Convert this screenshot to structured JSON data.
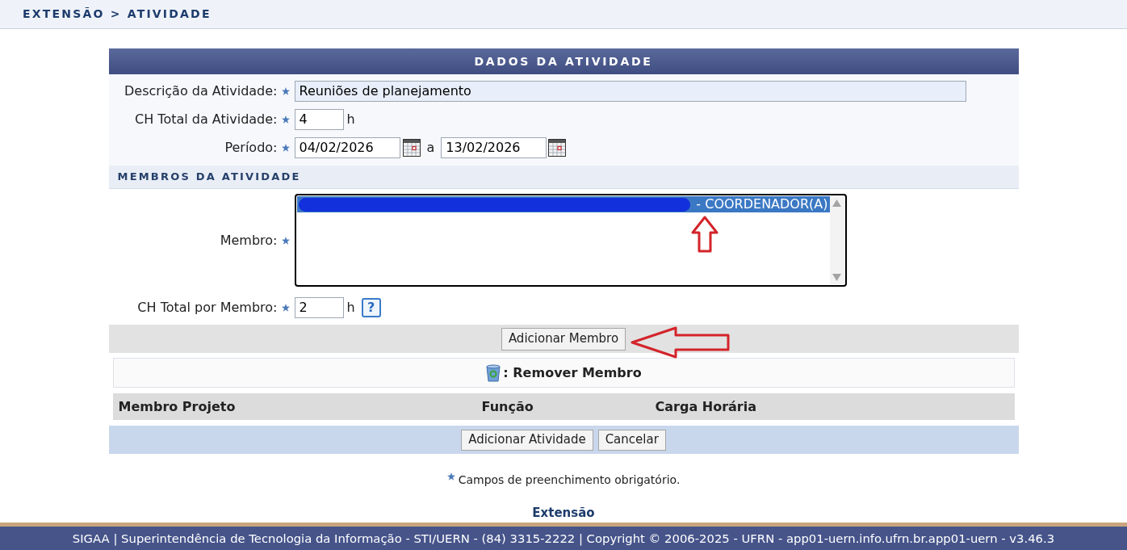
{
  "breadcrumb": "EXTENSÃO > ATIVIDADE",
  "panel": {
    "title": "DADOS DA ATIVIDADE"
  },
  "activity_fields": {
    "description": {
      "label": "Descrição da Atividade:",
      "required": true,
      "value": "Reuniões de planejamento"
    },
    "total_hours": {
      "label": "CH Total da Atividade:",
      "required": true,
      "value": "4",
      "unit": "h"
    },
    "period": {
      "label": "Período:",
      "required": true,
      "start": "04/02/2026",
      "separator": "a",
      "end": "13/02/2026"
    }
  },
  "members_section": {
    "title": "MEMBROS DA ATIVIDADE",
    "member": {
      "label": "Membro:",
      "required": true,
      "options": [
        {
          "text": "- COORDENADOR(A)",
          "redacted": true,
          "selected": true
        }
      ]
    },
    "hours_per_member": {
      "label": "CH Total por Membro:",
      "required": true,
      "value": "2",
      "unit": "h",
      "help": "?"
    },
    "add_button": "Adicionar Membro",
    "remove_legend": ": Remover Membro",
    "table": {
      "columns": [
        "Membro Projeto",
        "Função",
        "Carga Horária"
      ]
    }
  },
  "buttons": [
    "Adicionar Atividade",
    "Cancelar"
  ],
  "required_note": "Campos de preenchimento obrigatório.",
  "module_name": "Extensão",
  "footer": "SIGAA | Superintendência de Tecnologia da Informação - STI/UERN - (84) 3315-2222 | Copyright © 2006-2025 - UFRN - app01-uern.info.ufrn.br.app01-uern - v3.46.3"
}
